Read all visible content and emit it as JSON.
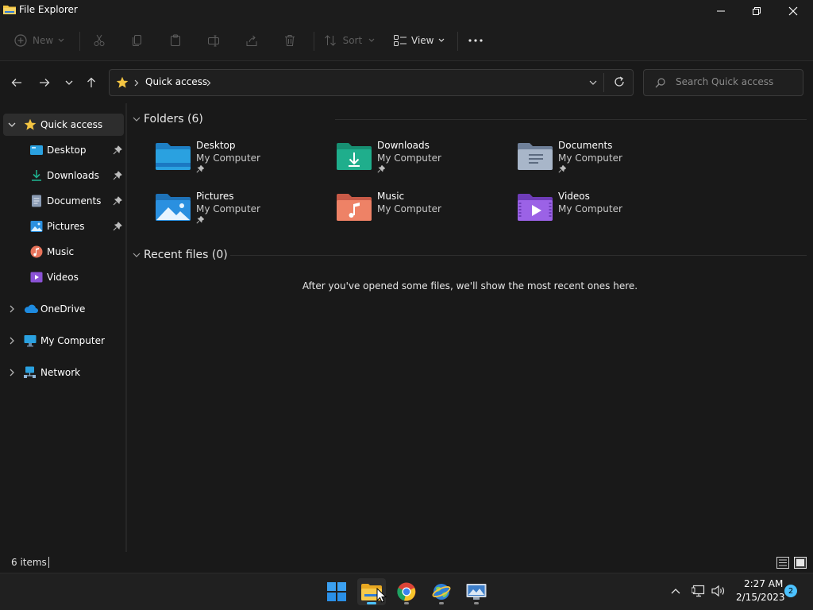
{
  "window": {
    "title": "File Explorer"
  },
  "toolbar": {
    "new_label": "New",
    "sort_label": "Sort",
    "view_label": "View"
  },
  "address": {
    "path_label": "Quick access",
    "search_placeholder": "Search Quick access"
  },
  "sidebar": {
    "items": [
      {
        "label": "Quick access"
      },
      {
        "label": "Desktop"
      },
      {
        "label": "Downloads"
      },
      {
        "label": "Documents"
      },
      {
        "label": "Pictures"
      },
      {
        "label": "Music"
      },
      {
        "label": "Videos"
      },
      {
        "label": "OneDrive"
      },
      {
        "label": "My Computer"
      },
      {
        "label": "Network"
      }
    ]
  },
  "main": {
    "folders_header": "Folders (6)",
    "folders": [
      {
        "name": "Desktop",
        "location": "My Computer",
        "icon": "desktop-folder-icon",
        "color": "#2aa1e0"
      },
      {
        "name": "Downloads",
        "location": "My Computer",
        "icon": "downloads-folder-icon",
        "color": "#1fae8c"
      },
      {
        "name": "Documents",
        "location": "My Computer",
        "icon": "documents-folder-icon",
        "color": "#8a9bb3"
      },
      {
        "name": "Pictures",
        "location": "My Computer",
        "icon": "pictures-folder-icon",
        "color": "#2a90e0"
      },
      {
        "name": "Music",
        "location": "My Computer",
        "icon": "music-folder-icon",
        "color": "#e8735a"
      },
      {
        "name": "Videos",
        "location": "My Computer",
        "icon": "videos-folder-icon",
        "color": "#8b52d6"
      }
    ],
    "recent_header": "Recent files (0)",
    "recent_empty_message": "After you've opened some files, we'll show the most recent ones here."
  },
  "status": {
    "item_count": "6 items"
  },
  "taskbar": {
    "time": "2:27 AM",
    "date": "2/15/2023",
    "notification_count": "2"
  },
  "colors": {
    "accent": "#4cc2ff",
    "folder_yellow": "#f4c542"
  }
}
